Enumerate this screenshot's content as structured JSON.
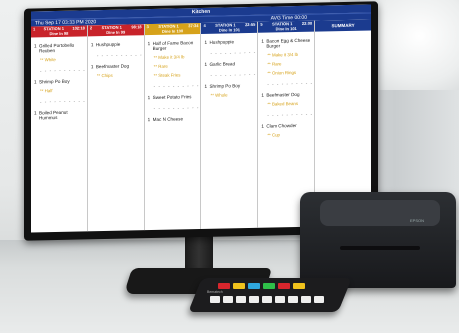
{
  "header": {
    "title": "Kitchen",
    "datetime": "Thu Sep 17 03:33 PM 2020",
    "avg_time": "AVG Time 00:00"
  },
  "stations": [
    {
      "name": "STATION 1",
      "num": "1",
      "time": "102:18",
      "dine": "Dine In 98",
      "color": "red",
      "items": [
        {
          "qty": "1",
          "name": "Grilled Portobello Reuben",
          "mods": [
            "** White"
          ]
        },
        {
          "dash": true
        },
        {
          "qty": "1",
          "name": "Shrimp Po Boy",
          "mods": [
            "** Half"
          ]
        },
        {
          "dash": true
        },
        {
          "qty": "1",
          "name": "Boiled Peanut Hummus",
          "mods": []
        }
      ]
    },
    {
      "name": "STATION 1",
      "num": "2",
      "time": "98:18",
      "dine": "Dine In 99",
      "color": "red",
      "items": [
        {
          "qty": "1",
          "name": "Hushpuppie",
          "mods": []
        },
        {
          "dash": true
        },
        {
          "qty": "1",
          "name": "Beefmaster Dog",
          "mods": [
            "** Chips"
          ]
        }
      ]
    },
    {
      "name": "STATION 1",
      "num": "3",
      "time": "37:34",
      "dine": "Dine In 100",
      "color": "gold",
      "items": [
        {
          "qty": "1",
          "name": "Half of Fame Bacon Burger",
          "mods": [
            "** Make it 3/4 lb",
            "** Rare",
            "** Steak Fries"
          ]
        },
        {
          "dash": true
        },
        {
          "qty": "1",
          "name": "Sweet Potato Fries",
          "mods": []
        },
        {
          "dash": true
        },
        {
          "qty": "1",
          "name": "Mac N Cheese",
          "mods": []
        }
      ]
    },
    {
      "name": "STATION 1",
      "num": "4",
      "time": "22:55",
      "dine": "Dine In 101",
      "color": "blue",
      "items": [
        {
          "qty": "1",
          "name": "Hushpuppie",
          "mods": []
        },
        {
          "dash": true
        },
        {
          "qty": "1",
          "name": "Garlic Bread",
          "mods": []
        },
        {
          "dash": true
        },
        {
          "qty": "1",
          "name": "Shrimp Po Boy",
          "mods": [
            "** Whole"
          ]
        }
      ]
    },
    {
      "name": "STATION 1",
      "num": "5",
      "time": "22:00",
      "dine": "Dine In 101",
      "color": "blue",
      "items": [
        {
          "qty": "1",
          "name": "Bacon Egg & Cheese Burger",
          "mods": [
            "** Make it 3/4 lb",
            "** Rare",
            "** Onion Rings"
          ]
        },
        {
          "dash": true
        },
        {
          "qty": "1",
          "name": "Beefmaster Dog",
          "mods": [
            "** Baked Beans"
          ]
        },
        {
          "dash": true
        },
        {
          "qty": "1",
          "name": "Clam Chowder",
          "mods": [
            "** Cup"
          ]
        }
      ]
    }
  ],
  "summary_label": "SUMMARY",
  "printer_brand": "EPSON",
  "keypad_brand": "Bematech",
  "colors": {
    "red": "#c8232a",
    "gold": "#d6a21a",
    "blue": "#1b3b8f"
  }
}
